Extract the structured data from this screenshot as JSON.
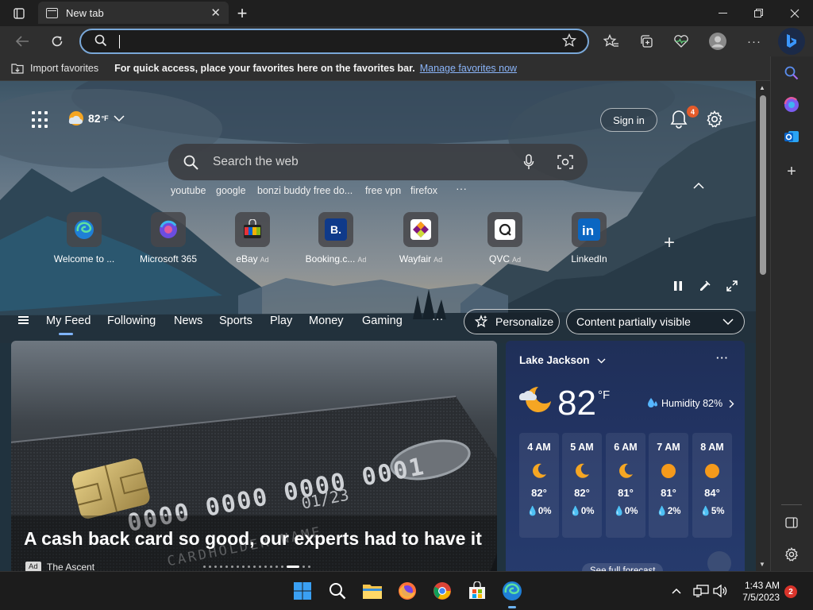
{
  "window": {
    "tab_title": "New tab",
    "controls": {
      "minimize": "minimize",
      "restore": "restore",
      "close": "close"
    }
  },
  "toolbar": {
    "address_value": "",
    "icons": [
      "back-icon",
      "refresh-icon",
      "search-icon",
      "favorite-star-icon",
      "favorites-icon",
      "collections-icon",
      "performance-heart-icon",
      "profile-avatar",
      "more-icon",
      "bing-copilot-icon"
    ]
  },
  "favbar": {
    "import_label": "Import favorites",
    "message": "For quick access, place your favorites here on the favorites bar.",
    "manage_link": "Manage favorites now"
  },
  "header": {
    "weather_temp": "82",
    "weather_unit": "°F",
    "signin_label": "Sign in",
    "notif_count": "4"
  },
  "search": {
    "placeholder": "Search the web",
    "suggestions": [
      "youtube",
      "google",
      "bonzi buddy free do...",
      "free vpn",
      "firefox"
    ],
    "more": "···"
  },
  "tiles": [
    {
      "label": "Welcome to ...",
      "ad": ""
    },
    {
      "label": "Microsoft 365",
      "ad": ""
    },
    {
      "label": "eBay",
      "ad": "Ad"
    },
    {
      "label": "Booking.c...",
      "ad": "Ad"
    },
    {
      "label": "Wayfair",
      "ad": "Ad"
    },
    {
      "label": "QVC",
      "ad": "Ad"
    },
    {
      "label": "LinkedIn",
      "ad": ""
    }
  ],
  "feed": {
    "tabs": [
      "My Feed",
      "Following",
      "News",
      "Sports",
      "Play",
      "Money",
      "Gaming"
    ],
    "more": "···",
    "personalize": "Personalize",
    "content_visibility": "Content partially visible"
  },
  "hero": {
    "headline": "A cash back card so good, our experts had to have it",
    "ad_tag": "Ad",
    "source": "The Ascent",
    "card_number": "0000 0000 0000 0001",
    "card_expiry": "01/23",
    "card_name": "CARDHOLDER NAME"
  },
  "weather": {
    "location": "Lake Jackson",
    "more": "···",
    "temp": "82",
    "unit": "°F",
    "humidity": "Humidity 82%",
    "hours": [
      {
        "h": "4 AM",
        "t": "82°",
        "p": "0%",
        "icon": "moon"
      },
      {
        "h": "5 AM",
        "t": "82°",
        "p": "0%",
        "icon": "moon"
      },
      {
        "h": "6 AM",
        "t": "81°",
        "p": "0%",
        "icon": "moon"
      },
      {
        "h": "7 AM",
        "t": "81°",
        "p": "2%",
        "icon": "sun"
      },
      {
        "h": "8 AM",
        "t": "84°",
        "p": "5%",
        "icon": "sun"
      }
    ],
    "forecast_link": "See full forecast"
  },
  "taskbar": {
    "time": "1:43 AM",
    "date": "7/5/2023",
    "notification_count": "2"
  }
}
